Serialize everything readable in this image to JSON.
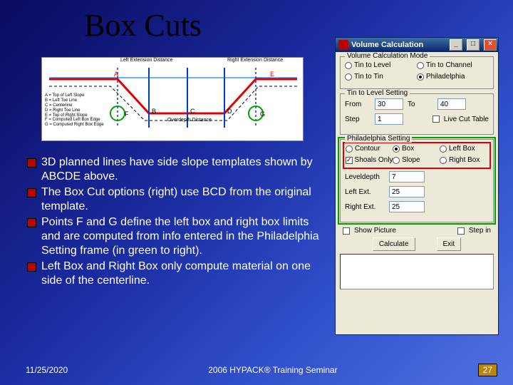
{
  "title": "Box Cuts",
  "bullets": [
    "3D planned lines have side slope templates shown by ABCDE above.",
    "The Box Cut options (right) use BCD from the original template.",
    "Points F and G define the left box and right box limits and are computed from info entered in the Philadelphia Setting frame (in green to right).",
    "Left Box and Right Box only compute material on one side of the centerline."
  ],
  "footer": {
    "date": "11/25/2020",
    "center": "2006 HYPACK® Training Seminar",
    "page": "27"
  },
  "dialog": {
    "title": "Volume Calculation",
    "winmin": "_",
    "winmax": "□",
    "winclose": "×",
    "mode_legend": "Volume Calculation Mode",
    "mode_options": [
      {
        "label": "Tin to Level",
        "checked": false
      },
      {
        "label": "Tin to Channel",
        "checked": false
      },
      {
        "label": "Tin to Tin",
        "checked": false
      },
      {
        "label": "Philadelphia",
        "checked": true
      }
    ],
    "tin_legend": "Tin to Level Setting",
    "from_label": "From",
    "from_val": "30",
    "to_label": "To",
    "to_val": "40",
    "step_label": "Step",
    "step_val": "1",
    "live_cut_label": "Live Cut Table",
    "phil_legend": "Philadelphia Setting",
    "phil_options": [
      {
        "label": "Contour",
        "checked": false
      },
      {
        "label": "Box",
        "checked": true
      },
      {
        "label": "Left Box",
        "checked": false
      },
      {
        "label": "Shoals Only",
        "checked": true,
        "type": "checkbox"
      },
      {
        "label": "Slope",
        "checked": false
      },
      {
        "label": "Right Box",
        "checked": false
      }
    ],
    "leveldepth_label": "Leveldepth",
    "leveldepth_val": "7",
    "left_ext_label": "Left Ext.",
    "left_ext_val": "25",
    "right_ext_label": "Right Ext.",
    "right_ext_val": "25",
    "show_picture": "Show Picture",
    "step_in": "Step in",
    "calculate": "Calculate",
    "exit": "Exit"
  },
  "diagram": {
    "left_ext": "Left\nExtension\nDistance",
    "right_ext": "Right\nExtension\nDistance",
    "overdepth": "Overdepth\nDistance",
    "legend": "A = Top of Left Slope\nB = Left Toe Line\nC = Centerline\nD = Right Toe Line\nE = Top of Right Slope\nF = Computed Left Box Edge\nG = Computed Right Box Edge",
    "A": "A",
    "B": "B",
    "C": "C",
    "D": "D",
    "E": "E",
    "F": "F",
    "G": "G"
  }
}
